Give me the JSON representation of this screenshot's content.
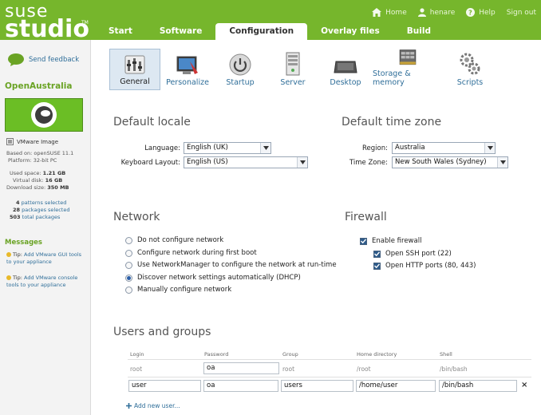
{
  "header": {
    "logo_line1": "suse",
    "logo_line2": "studio",
    "logo_tm": "TM",
    "nav": {
      "home": "Home",
      "user": "henare",
      "help": "Help",
      "signout": "Sign out"
    },
    "tabs": [
      "Start",
      "Software",
      "Configuration",
      "Overlay files",
      "Build"
    ],
    "active_tab": "Configuration"
  },
  "sidebar": {
    "feedback": "Send feedback",
    "app_name": "OpenAustralia",
    "image_type": "VMware Image",
    "based_on_label": "Based on:",
    "based_on": "openSUSE 11.1",
    "platform_label": "Platform:",
    "platform": "32-bit PC",
    "used_space_label": "Used space:",
    "used_space": "1.21 GB",
    "virtual_disk_label": "Virtual disk:",
    "virtual_disk": "16 GB",
    "download_size_label": "Download size:",
    "download_size": "350 MB",
    "patterns_count": "4",
    "patterns_text": "patterns selected",
    "packages_count": "28",
    "packages_text": "packages selected",
    "total_count": "503",
    "total_text": "total packages",
    "messages_title": "Messages",
    "tips": [
      {
        "prefix": "Tip:",
        "text": "Add VMware GUI tools to your appliance"
      },
      {
        "prefix": "Tip:",
        "text": "Add VMware console tools to your appliance"
      }
    ]
  },
  "config_nav": {
    "items": [
      "General",
      "Personalize",
      "Startup",
      "Server",
      "Desktop",
      "Storage & memory",
      "Scripts"
    ],
    "active": "General"
  },
  "locale": {
    "title": "Default locale",
    "language_label": "Language:",
    "language": "English (UK)",
    "keyboard_label": "Keyboard Layout:",
    "keyboard": "English (US)"
  },
  "timezone": {
    "title": "Default time zone",
    "region_label": "Region:",
    "region": "Australia",
    "zone_label": "Time Zone:",
    "zone": "New South Wales (Sydney)"
  },
  "network": {
    "title": "Network",
    "options": [
      "Do not configure network",
      "Configure network during first boot",
      "Use NetworkManager to configure the network at run-time",
      "Discover network settings automatically (DHCP)",
      "Manually configure network"
    ],
    "selected_index": 3
  },
  "firewall": {
    "title": "Firewall",
    "enable": "Enable firewall",
    "ssh": "Open SSH port (22)",
    "http": "Open HTTP ports (80, 443)"
  },
  "users": {
    "title": "Users and groups",
    "columns": [
      "Login",
      "Password",
      "Group",
      "Home directory",
      "Shell"
    ],
    "root_row": {
      "login": "root",
      "password": "oa",
      "group": "root",
      "home": "/root",
      "shell": "/bin/bash"
    },
    "user_row": {
      "login": "user",
      "password": "oa",
      "group": "users",
      "home": "/home/user",
      "shell": "/bin/bash"
    },
    "delete": "×",
    "add": "Add new user..."
  },
  "colors": {
    "brand_green": "#76b62c",
    "link_blue": "#2f6e99",
    "active_tab_bg": "#ffffff"
  }
}
